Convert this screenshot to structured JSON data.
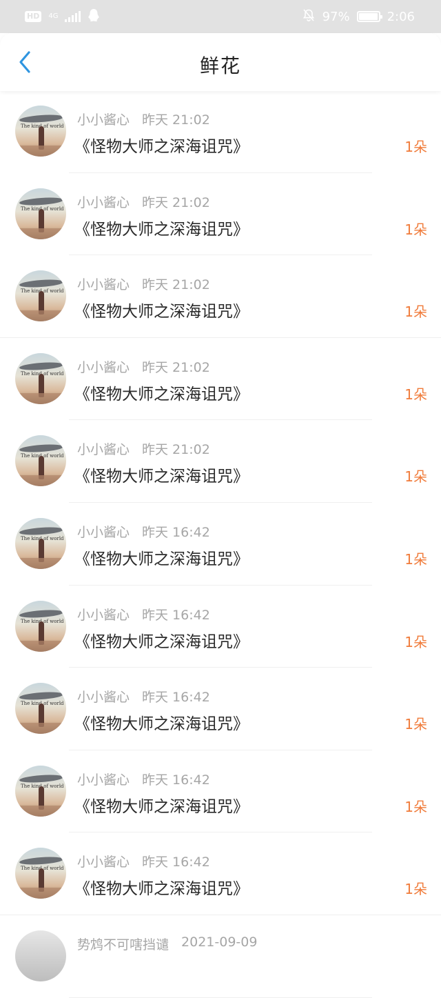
{
  "status_bar": {
    "hd": "HD",
    "network": "4G",
    "battery_percent": "97%",
    "battery_level": 0.97,
    "time": "2:06"
  },
  "header": {
    "title": "鲜花"
  },
  "items": [
    {
      "user": "小小酱心",
      "time": "昨天 21:02",
      "book": "《怪物大师之深海诅咒》",
      "count": "1朵"
    },
    {
      "user": "小小酱心",
      "time": "昨天 21:02",
      "book": "《怪物大师之深海诅咒》",
      "count": "1朵"
    },
    {
      "user": "小小酱心",
      "time": "昨天 21:02",
      "book": "《怪物大师之深海诅咒》",
      "count": "1朵"
    },
    {
      "user": "小小酱心",
      "time": "昨天 21:02",
      "book": "《怪物大师之深海诅咒》",
      "count": "1朵"
    },
    {
      "user": "小小酱心",
      "time": "昨天 21:02",
      "book": "《怪物大师之深海诅咒》",
      "count": "1朵"
    },
    {
      "user": "小小酱心",
      "time": "昨天 16:42",
      "book": "《怪物大师之深海诅咒》",
      "count": "1朵"
    },
    {
      "user": "小小酱心",
      "time": "昨天 16:42",
      "book": "《怪物大师之深海诅咒》",
      "count": "1朵"
    },
    {
      "user": "小小酱心",
      "time": "昨天 16:42",
      "book": "《怪物大师之深海诅咒》",
      "count": "1朵"
    },
    {
      "user": "小小酱心",
      "time": "昨天 16:42",
      "book": "《怪物大师之深海诅咒》",
      "count": "1朵"
    },
    {
      "user": "小小酱心",
      "time": "昨天 16:42",
      "book": "《怪物大师之深海诅咒》",
      "count": "1朵"
    },
    {
      "user": "势鸩不可嗐挡谴",
      "time": "2021-09-09",
      "book": "",
      "count": ""
    }
  ],
  "colors": {
    "accent_blue": "#2f95e0",
    "count_orange": "#f07b3a"
  }
}
